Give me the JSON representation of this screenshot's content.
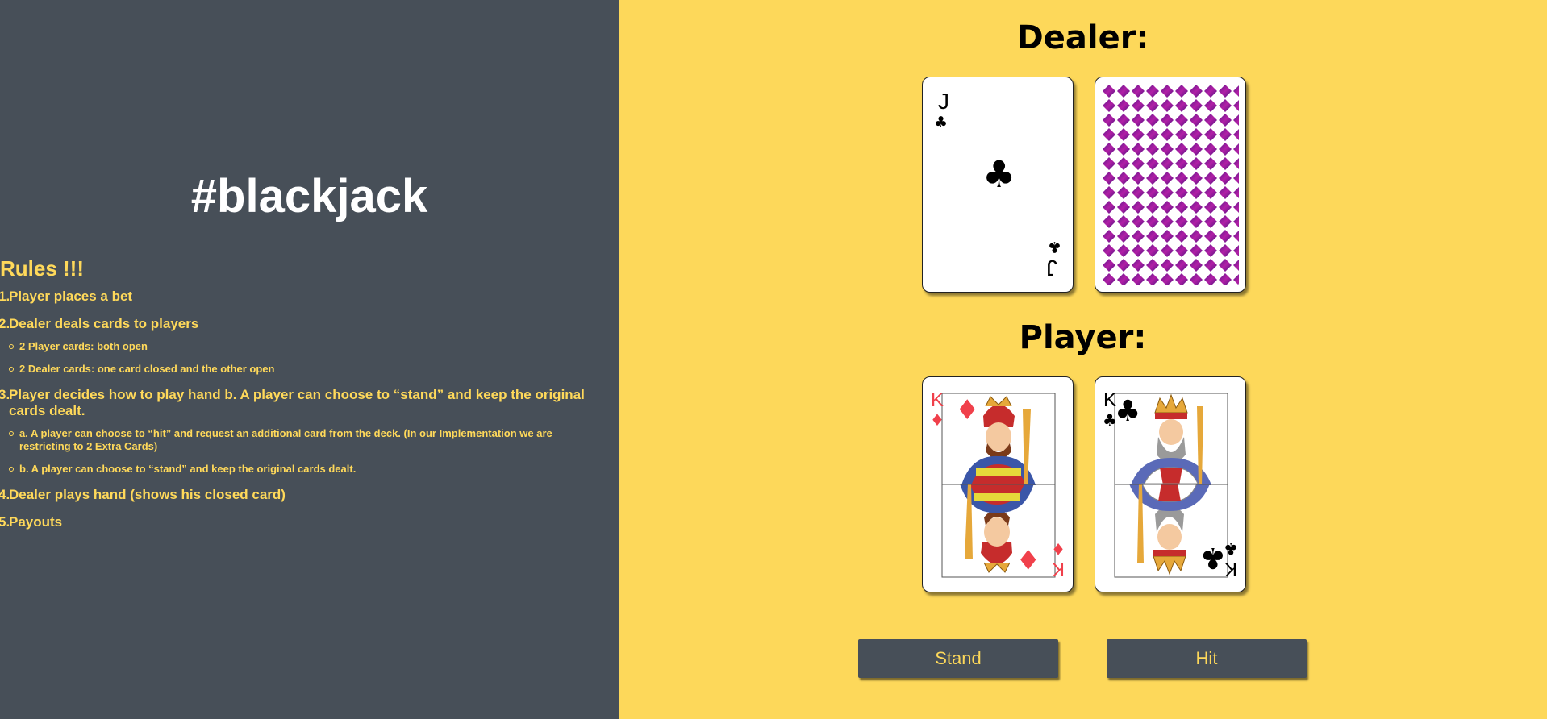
{
  "sidebar": {
    "title": "#blackjack",
    "rules_heading": "Rules !!!",
    "rules": [
      {
        "num": "1.",
        "text": "Player places a bet"
      },
      {
        "num": "2.",
        "text": "Dealer deals cards to players",
        "sub": [
          "2 Player cards: both open",
          "2 Dealer cards: one card closed and the other open"
        ]
      },
      {
        "num": "3.",
        "text": "Player decides how to play hand b. A player can choose to “stand” and keep the original cards dealt.",
        "sub": [
          "a. A player can choose to “hit” and request an additional card from the deck. (In our Implementation we are restricting to 2 Extra Cards)",
          "b. A player can choose to “stand” and keep the original cards dealt."
        ]
      },
      {
        "num": "4.",
        "text": "Dealer plays hand (shows his closed card)"
      },
      {
        "num": "5.",
        "text": "Payouts"
      }
    ]
  },
  "table": {
    "dealer_label": "Dealer:",
    "player_label": "Player:",
    "dealer_cards": [
      {
        "rank": "J",
        "suit": "clubs",
        "face": "up"
      },
      {
        "rank": "",
        "suit": "",
        "face": "down"
      }
    ],
    "player_cards": [
      {
        "rank": "K",
        "suit": "diamonds",
        "face": "up"
      },
      {
        "rank": "K",
        "suit": "clubs",
        "face": "up"
      }
    ]
  },
  "controls": {
    "stand_label": "Stand",
    "hit_label": "Hit"
  },
  "colors": {
    "sidebar_bg": "#474f58",
    "table_bg": "#fdd85a",
    "accent_text": "#ffd95a",
    "card_back": "#8e1a9e",
    "diamond_red": "#f0404b"
  }
}
